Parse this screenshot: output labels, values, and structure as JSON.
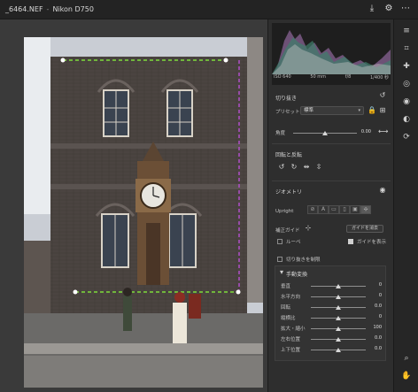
{
  "titlebar": {
    "filename": "_6464.NEF",
    "camera": "Nikon D750"
  },
  "histogram": {
    "iso": "ISO 640",
    "focal": "50 mm",
    "aperture": "f/8",
    "shutter": "1/400 秒"
  },
  "crop": {
    "title": "切り抜き",
    "preset_label": "プリセット",
    "preset_value": "標準",
    "angle_label": "角度",
    "angle_value": "0.00"
  },
  "rotate": {
    "title": "回転と反転"
  },
  "geometry": {
    "title": "ジオメトリ",
    "upright_label": "Upright",
    "guides_label": "補正ガイド",
    "guides_button": "ガイドを消去",
    "loupe_label": "ルーペ",
    "show_guides_label": "ガイドを表示",
    "constrain_label": "切り抜きを制限",
    "manual_label": "手動変換",
    "sliders": [
      {
        "label": "垂直",
        "value": "0"
      },
      {
        "label": "水平方向",
        "value": "0"
      },
      {
        "label": "回転",
        "value": "0.0"
      },
      {
        "label": "縦横比",
        "value": "0"
      },
      {
        "label": "拡大・縮小",
        "value": "100"
      },
      {
        "label": "左右位置",
        "value": "0.0"
      },
      {
        "label": "上下位置",
        "value": "0.0"
      }
    ]
  },
  "colors": {
    "accent": "#e8e8e8",
    "crop_guide": "#7ddc3a",
    "crop_side": "#b04fc9"
  }
}
